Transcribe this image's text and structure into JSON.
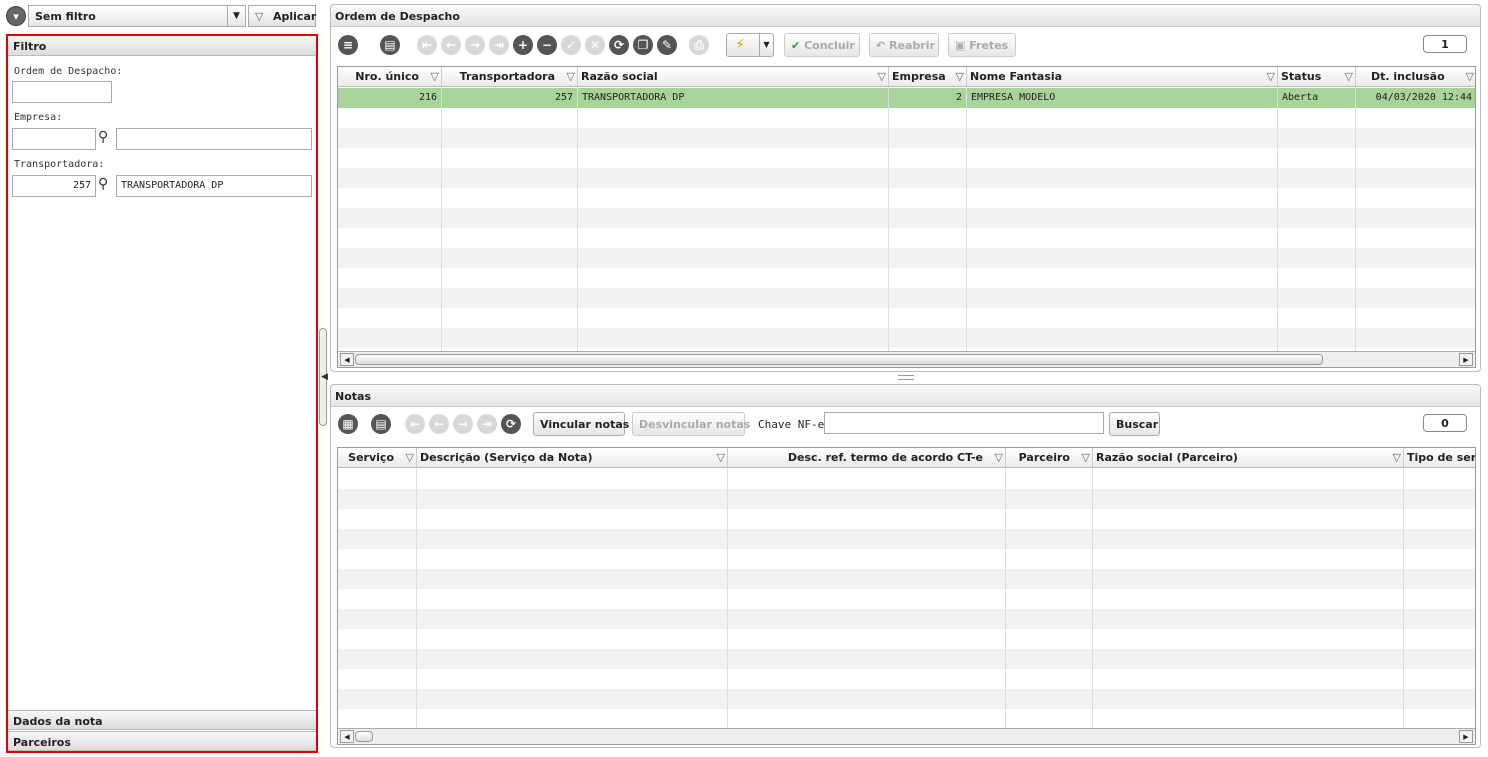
{
  "left": {
    "filter_selector": "Sem filtro",
    "apply_label": "Aplicar",
    "panel_title": "Filtro",
    "fields": {
      "ordem_label": "Ordem de Despacho:",
      "ordem_value": "",
      "empresa_label": "Empresa:",
      "empresa_code": "",
      "empresa_name": "",
      "transportadora_label": "Transportadora:",
      "transportadora_code": "257",
      "transportadora_name": "TRANSPORTADORA DP"
    },
    "sections": [
      "Dados da nota",
      "Parceiros"
    ]
  },
  "despacho": {
    "title": "Ordem de Despacho",
    "buttons": {
      "concluir": "Concluir",
      "reabrir": "Reabrir",
      "fretes": "Fretes"
    },
    "count": "1",
    "columns": [
      "Nro. único",
      "Transportadora",
      "Razão social",
      "Empresa",
      "Nome Fantasia",
      "Status",
      "Dt. inclusão"
    ],
    "rows": [
      {
        "nro": "216",
        "transportadora": "257",
        "razao": "TRANSPORTADORA DP",
        "empresa": "2",
        "fantasia": "EMPRESA MODELO",
        "status": "Aberta",
        "dt": "04/03/2020 12:44"
      }
    ],
    "selected_row_color": "#a8d49a"
  },
  "notas": {
    "title": "Notas",
    "buttons": {
      "vincular": "Vincular notas",
      "desvincular": "Desvincular notas",
      "buscar": "Buscar"
    },
    "chave_label": "Chave NF-e",
    "chave_value": "",
    "count": "0",
    "columns": [
      "Serviço",
      "Descrição (Serviço da Nota)",
      "Desc. ref. termo de acordo CT-e",
      "Parceiro",
      "Razão social (Parceiro)",
      "Tipo de servi"
    ]
  }
}
